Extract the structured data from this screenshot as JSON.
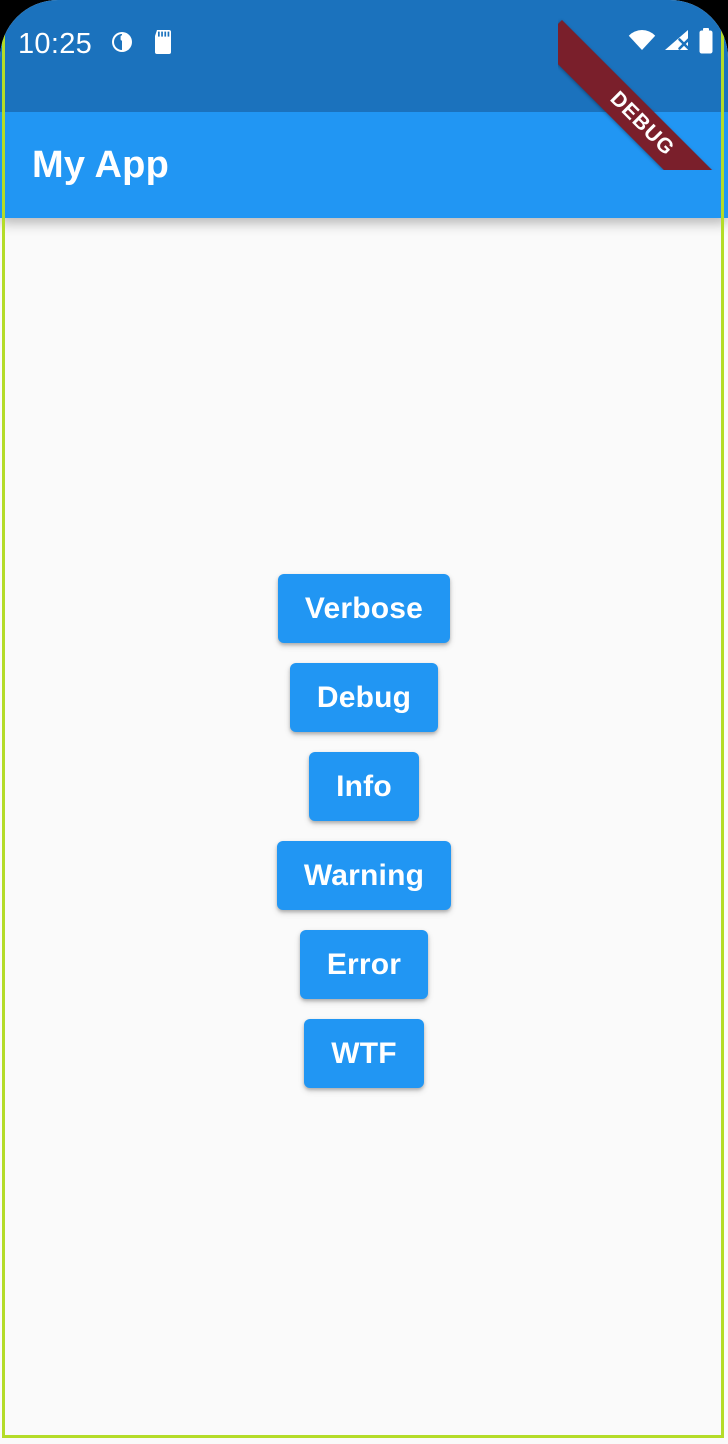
{
  "platform": "android",
  "status_bar": {
    "time": "10:25",
    "left_icons": [
      "clock-alarm-icon",
      "sd-card-icon"
    ],
    "right_icons": [
      "wifi-icon",
      "cellular-signal-off-icon",
      "battery-icon"
    ],
    "background_color": "#1b72bd",
    "text_color": "#ffffff"
  },
  "debug_banner": {
    "label": "DEBUG",
    "color": "#7a1f2b",
    "text_color": "#ffffff"
  },
  "app_bar": {
    "title": "My App",
    "background_color": "#2196f3",
    "text_color": "#ffffff"
  },
  "body": {
    "background_color": "#fafafa",
    "debug_paint_border_color": "#b4dc28",
    "buttons": [
      {
        "label": "Verbose"
      },
      {
        "label": "Debug"
      },
      {
        "label": "Info"
      },
      {
        "label": "Warning"
      },
      {
        "label": "Error"
      },
      {
        "label": "WTF"
      }
    ],
    "button_background_color": "#2196f3",
    "button_text_color": "#ffffff"
  }
}
